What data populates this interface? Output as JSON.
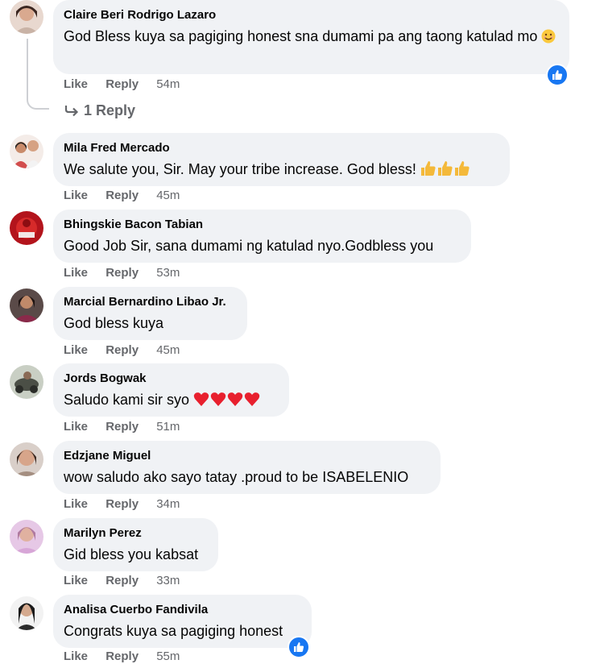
{
  "colors": {
    "bubble": "#f0f2f5",
    "meta": "#65676b",
    "like_blue": "#1877f2"
  },
  "comments": [
    {
      "author": "Claire Beri Rodrigo Lazaro",
      "text": "God Bless kuya sa pagiging honest sna dumami pa ang taong katulad mo",
      "emoji": "smiling-face-icon",
      "like": "Like",
      "reply": "Reply",
      "time": "54m",
      "replies_label": "1 Reply",
      "reaction": "like-icon"
    },
    {
      "author": "Mila Fred Mercado",
      "text": "We salute you, Sir. May your tribe increase. God bless!",
      "emoji": "thumbs-up-icon x3",
      "like": "Like",
      "reply": "Reply",
      "time": "45m"
    },
    {
      "author": "Bhingskie Bacon Tabian",
      "text": "Good Job Sir, sana dumami ng katulad nyo.Godbless you",
      "like": "Like",
      "reply": "Reply",
      "time": "53m"
    },
    {
      "author": "Marcial Bernardino Libao Jr.",
      "text": "God bless kuya",
      "like": "Like",
      "reply": "Reply",
      "time": "45m"
    },
    {
      "author": "Jords Bogwak",
      "text": "Saludo kami sir syo",
      "emoji": "heart-icon x4",
      "like": "Like",
      "reply": "Reply",
      "time": "51m"
    },
    {
      "author": "Edzjane Miguel",
      "text": "wow saludo ako sayo tatay .proud to be ISABELENIO",
      "like": "Like",
      "reply": "Reply",
      "time": "34m"
    },
    {
      "author": "Marilyn Perez",
      "text": "Gid bless you kabsat",
      "like": "Like",
      "reply": "Reply",
      "time": "33m"
    },
    {
      "author": "Analisa Cuerbo Fandivila",
      "text": "Congrats kuya sa pagiging honest",
      "like": "Like",
      "reply": "Reply",
      "time": "55m",
      "reaction": "like-icon"
    }
  ]
}
